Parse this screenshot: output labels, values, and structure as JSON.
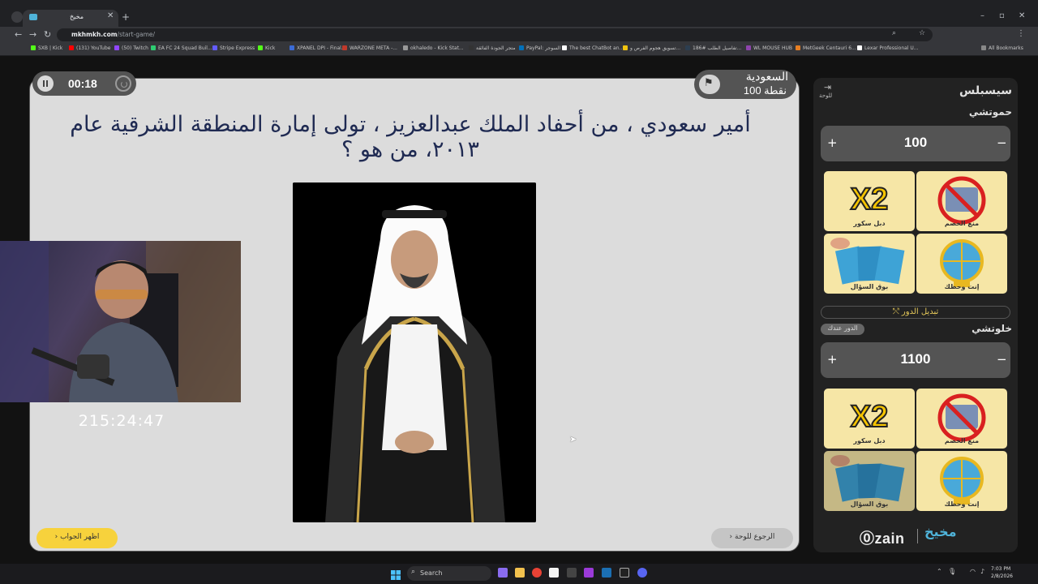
{
  "browser": {
    "tab_title": "مخيخ",
    "url_domain": "mkhmkh.com",
    "url_path": "/start-game/",
    "bookmarks": [
      {
        "label": "SXB | Kick",
        "color": "#53fc18"
      },
      {
        "label": "(131) YouTube",
        "color": "#ff0000"
      },
      {
        "label": "(50) Twitch",
        "color": "#9146ff"
      },
      {
        "label": "EA FC 24 Squad Buil...",
        "color": "#2ecc71"
      },
      {
        "label": "Stripe Express",
        "color": "#635bff"
      },
      {
        "label": "Kick",
        "color": "#53fc18"
      },
      {
        "label": "XPANEL DPI - Final...",
        "color": "#3b6bd6"
      },
      {
        "label": "WARZONE META -...",
        "color": "#c0392b"
      },
      {
        "label": "okhaledo - Kick Stat...",
        "color": "#999999"
      },
      {
        "label": "متجر الجودة الفائقة",
        "color": "#333333"
      },
      {
        "label": "PayPal: السوجر",
        "color": "#0070ba"
      },
      {
        "label": "The best ChatBot an...",
        "color": "#ffffff"
      },
      {
        "label": "تسويق هجوم الفرص و...",
        "color": "#f1c40f"
      },
      {
        "label": "تفاصيل الطلب #186...",
        "color": "#2c3e50"
      },
      {
        "label": "WL MOUSE HUB",
        "color": "#8e44ad"
      },
      {
        "label": "MetGeek Centauri 6...",
        "color": "#e67e22"
      },
      {
        "label": "Lexar Professional U...",
        "color": "#ffffff"
      }
    ],
    "all_bookmarks": "All Bookmarks"
  },
  "game": {
    "timer": "00:18",
    "team_name": "السعودية",
    "team_points": "100 نقطة",
    "question": "أمير سعودي ، من أحفاد الملك عبدالعزيز ، تولى إمارة المنطقة الشرقية عام ٢٠١٣، من هو ؟",
    "show_answer": "اظهر الجواب",
    "back_to_board": "الرجوع للوحة"
  },
  "stream": {
    "clock": "215:24:47"
  },
  "sidebar": {
    "title": "سيسبلس",
    "board_link": "للوحة",
    "switch_turn": "تبديل الدور",
    "zain": "zain",
    "brand": "مخيخ",
    "teams": [
      {
        "name": "حموتشي",
        "score": "100",
        "cards": [
          {
            "label": "منع الخصم",
            "icon": "block-user-icon"
          },
          {
            "label": "دبل سكور",
            "icon": "x2-icon"
          },
          {
            "label": "إنت وحظك",
            "icon": "wheel-icon"
          },
          {
            "label": "بوق السؤال",
            "icon": "cards-icon"
          }
        ]
      },
      {
        "name": "خلوتشي",
        "score": "1100",
        "turn_badge": "الدور عندك",
        "cards": [
          {
            "label": "منع الخصم",
            "icon": "block-user-icon"
          },
          {
            "label": "دبل سكور",
            "icon": "x2-icon"
          },
          {
            "label": "إنت وحظك",
            "icon": "wheel-icon"
          },
          {
            "label": "بوق السؤال",
            "icon": "cards-icon"
          }
        ]
      }
    ]
  },
  "taskbar": {
    "search": "Search",
    "time": "7:03 PM",
    "date": "2/8/2026"
  }
}
